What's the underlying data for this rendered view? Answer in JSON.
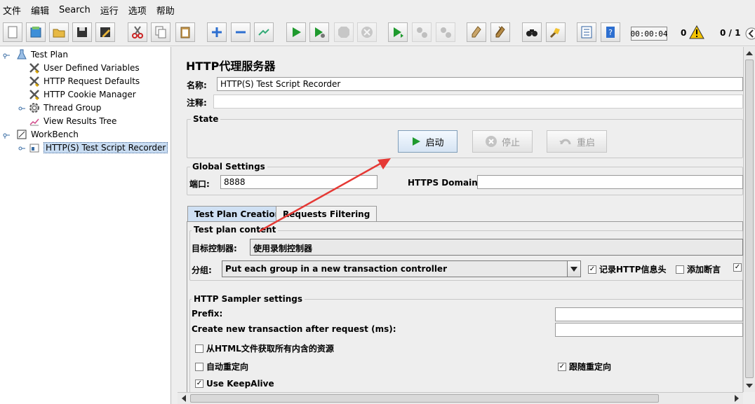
{
  "menu": [
    "文件",
    "编辑",
    "Search",
    "运行",
    "选项",
    "帮助"
  ],
  "toolbar": {
    "buttons": [
      "new-icon",
      "templates-icon",
      "open-icon",
      "save-icon",
      "save-as-icon",
      "cut-icon",
      "copy-icon",
      "paste-icon",
      "expand-icon",
      "collapse-icon",
      "toggle-icon",
      "start-icon",
      "start-no-pauses-icon",
      "stop-icon",
      "shutdown-icon",
      "remote-start-icon",
      "remote-stop-icon",
      "remote-shutdown-icon",
      "clear-icon",
      "clear-all-icon",
      "search-icon",
      "reset-search-icon",
      "function-helper-icon",
      "help-icon"
    ],
    "timer": "00:00:04",
    "error_count": "0",
    "threads": "0 / 1"
  },
  "tree": {
    "nodes": [
      {
        "label": "Test Plan",
        "icon": "test-plan-icon",
        "level": 0
      },
      {
        "label": "User Defined Variables",
        "icon": "wrench-icon",
        "level": 1
      },
      {
        "label": "HTTP Request Defaults",
        "icon": "wrench-icon",
        "level": 1
      },
      {
        "label": "HTTP Cookie Manager",
        "icon": "wrench-icon",
        "level": 1
      },
      {
        "label": "Thread Group",
        "icon": "gear-icon",
        "level": 1
      },
      {
        "label": "View Results Tree",
        "icon": "chart-icon",
        "level": 1
      },
      {
        "label": "WorkBench",
        "icon": "workbench-icon",
        "level": 0
      },
      {
        "label": "HTTP(S) Test Script Recorder",
        "icon": "recorder-icon",
        "level": 1,
        "selected": true
      }
    ]
  },
  "panel": {
    "title": "HTTP代理服务器",
    "name_label": "名称:",
    "name_value": "HTTP(S) Test Script Recorder",
    "comment_label": "注释:",
    "comment_value": "",
    "state_title": "State",
    "start_label": "启动",
    "stop_label": "停止",
    "restart_label": "重启",
    "global_title": "Global Settings",
    "port_label": "端口:",
    "port_value": "8888",
    "https_label": "HTTPS Domains:",
    "https_value": "",
    "tabs": [
      "Test Plan Creation",
      "Requests Filtering"
    ],
    "content_title": "Test plan content",
    "target_label": "目标控制器:",
    "target_value": "使用录制控制器",
    "grouping_label": "分组:",
    "grouping_value": "Put each group in a new transaction controller",
    "record_headers": "记录HTTP信息头",
    "add_assertions": "添加断言",
    "sampler_title": "HTTP Sampler settings",
    "prefix_label": "Prefix:",
    "prefix_value": "",
    "new_tx_label": "Create new transaction after request (ms):",
    "new_tx_value": "",
    "retrieve_all": "从HTML文件获取所有内含的资源",
    "auto_redirect": "自动重定向",
    "follow_redirects": "跟随重定向",
    "keepalive": "Use KeepAlive"
  },
  "colors": {
    "arrow": "#e53935",
    "selection": "#c8dcf2",
    "play": "#1f9a2e"
  }
}
